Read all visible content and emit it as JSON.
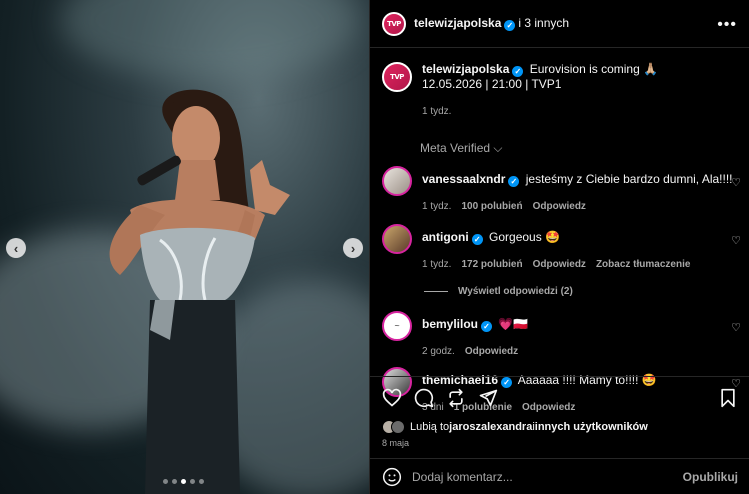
{
  "post": {
    "header_username": "telewizjapolska",
    "header_collab": "i 3 innych",
    "author": "telewizjapolska",
    "caption_text": "Eurovision is coming 🙏🏼",
    "caption_line2": "12.05.2026 | 21:00 | TVP1",
    "caption_time": "1 tydz.",
    "meta_verified": "Meta Verified ⌵",
    "media_dots": 5,
    "media_active_dot": 2
  },
  "comments": [
    {
      "username": "vanessaalxndr",
      "verified": true,
      "text": "jesteśmy z Ciebie bardzo dumni, Ala!!!!",
      "time": "1 tydz.",
      "likes": "100 polubień",
      "reply": "Odpowiedz",
      "translate": ""
    },
    {
      "username": "antigoni",
      "verified": true,
      "text": "Gorgeous 🤩",
      "time": "1 tydz.",
      "likes": "172 polubień",
      "reply": "Odpowiedz",
      "translate": "Zobacz tłumaczenie"
    },
    {
      "username": "bemylilou",
      "verified": true,
      "text": "💗🇵🇱",
      "time": "2 godz.",
      "likes": "",
      "reply": "Odpowiedz",
      "translate": ""
    },
    {
      "username": "themichael16",
      "verified": true,
      "text": "Aaaaaa !!!! Mamy to!!!! 🤩",
      "time": "3 dni",
      "likes": "1 polubienie",
      "reply": "Odpowiedz",
      "translate": ""
    }
  ],
  "view_replies": "Wyświetl odpowiedzi (2)",
  "likes_line": {
    "prefix": "Lubią to ",
    "user": "jaroszalexandra",
    "middle": " i ",
    "rest": "innych użytkowników"
  },
  "post_date": "8 maja",
  "comment_input": {
    "placeholder": "Dodaj komentarz...",
    "value": ""
  },
  "publish_label": "Opublikuj",
  "avatar_logo": "TVP",
  "colors": {
    "verified": "#0095f6",
    "heart": "#ff3040",
    "panel_bg": "#000000",
    "muted": "#a8a8a8"
  }
}
